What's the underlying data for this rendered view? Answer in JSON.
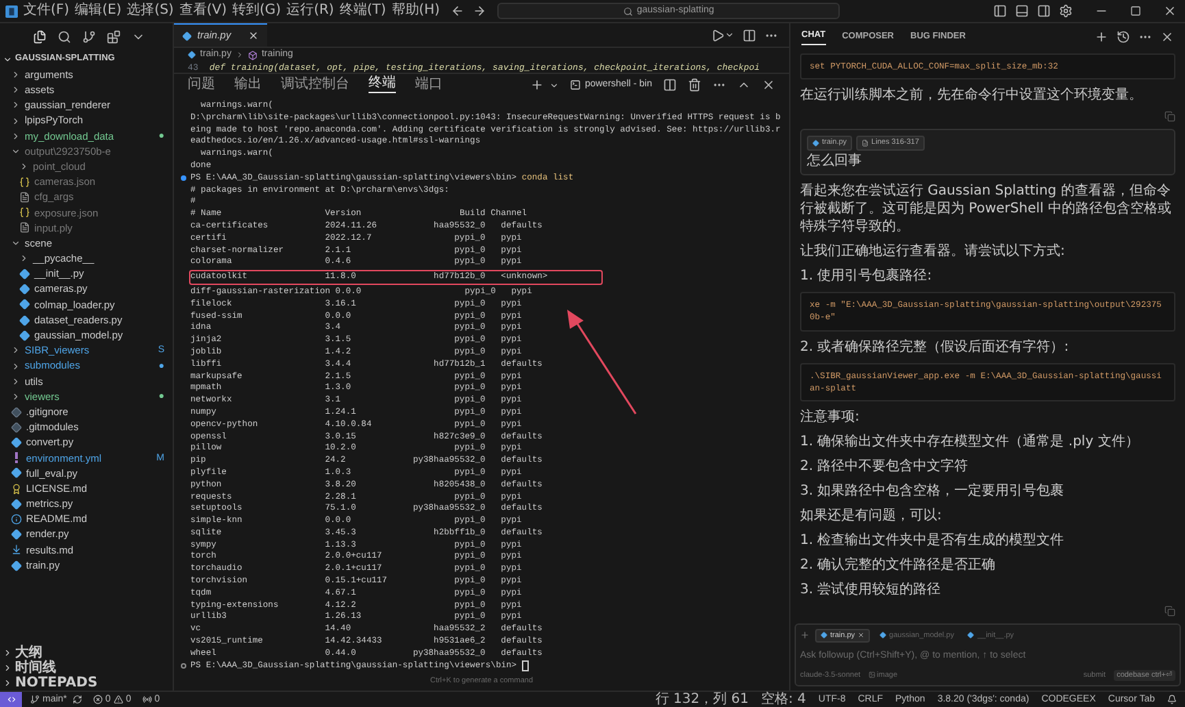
{
  "menu": [
    "文件(F)",
    "编辑(E)",
    "选择(S)",
    "查看(V)",
    "转到(G)",
    "运行(R)",
    "终端(T)",
    "帮助(H)"
  ],
  "search": {
    "value": "gaussian-splatting"
  },
  "explorer": {
    "title": "GAUSSIAN-SPLATTING",
    "items": [
      {
        "name": "arguments",
        "kind": "folder",
        "expanded": false
      },
      {
        "name": "assets",
        "kind": "folder",
        "expanded": false
      },
      {
        "name": "gaussian_renderer",
        "kind": "folder",
        "expanded": false
      },
      {
        "name": "lpipsPyTorch",
        "kind": "folder",
        "expanded": false
      },
      {
        "name": "my_download_data",
        "kind": "folder",
        "expanded": false,
        "color": "#73c991",
        "badge": "●"
      },
      {
        "name": "output\\2923750b-e",
        "kind": "folder",
        "expanded": true,
        "color": "#7a7a7a",
        "children": [
          {
            "name": "point_cloud",
            "kind": "folder",
            "expanded": false,
            "color": "#7a7a7a"
          },
          {
            "name": "cameras.json",
            "kind": "json",
            "color": "#7a7a7a"
          },
          {
            "name": "cfg_args",
            "kind": "text",
            "color": "#7a7a7a"
          },
          {
            "name": "exposure.json",
            "kind": "json",
            "color": "#7a7a7a"
          },
          {
            "name": "input.ply",
            "kind": "text",
            "color": "#7a7a7a"
          }
        ]
      },
      {
        "name": "scene",
        "kind": "folder",
        "expanded": true,
        "children": [
          {
            "name": "__pycache__",
            "kind": "folder",
            "expanded": false
          },
          {
            "name": "__init__.py",
            "kind": "python"
          },
          {
            "name": "cameras.py",
            "kind": "python"
          },
          {
            "name": "colmap_loader.py",
            "kind": "python"
          },
          {
            "name": "dataset_readers.py",
            "kind": "python"
          },
          {
            "name": "gaussian_model.py",
            "kind": "python"
          }
        ]
      },
      {
        "name": "SIBR_viewers",
        "kind": "folder",
        "expanded": false,
        "color": "#4fa5e8",
        "badge": "S"
      },
      {
        "name": "submodules",
        "kind": "folder",
        "expanded": false,
        "color": "#4fa5e8",
        "badge": "●"
      },
      {
        "name": "utils",
        "kind": "folder",
        "expanded": false
      },
      {
        "name": "viewers",
        "kind": "folder",
        "expanded": false,
        "color": "#73c991",
        "badge": "●"
      },
      {
        "name": ".gitignore",
        "kind": "git"
      },
      {
        "name": ".gitmodules",
        "kind": "git"
      },
      {
        "name": "convert.py",
        "kind": "python"
      },
      {
        "name": "environment.yml",
        "kind": "yaml",
        "color": "#4fa5e8",
        "badge": "M"
      },
      {
        "name": "full_eval.py",
        "kind": "python"
      },
      {
        "name": "LICENSE.md",
        "kind": "license"
      },
      {
        "name": "metrics.py",
        "kind": "python"
      },
      {
        "name": "README.md",
        "kind": "info"
      },
      {
        "name": "render.py",
        "kind": "python"
      },
      {
        "name": "results.md",
        "kind": "download"
      },
      {
        "name": "train.py",
        "kind": "python"
      }
    ]
  },
  "sections": [
    "大纲",
    "时间线",
    "NOTEPADS"
  ],
  "editor": {
    "tabs": [
      {
        "label": "train.py",
        "selected": true
      }
    ],
    "breadcrumbs": [
      "train.py",
      "training"
    ],
    "lines": [
      {
        "number": "43",
        "code": "def training(dataset, opt, pipe, testing_iterations, saving_iterations, checkpoint_iterations, checkpoi"
      }
    ]
  },
  "panel": {
    "tabs": [
      {
        "label": "问题",
        "selected": false
      },
      {
        "label": "输出",
        "selected": false
      },
      {
        "label": "调试控制台",
        "selected": false
      },
      {
        "label": "终端",
        "selected": true
      },
      {
        "label": "端口",
        "selected": false
      }
    ],
    "terminal_name": "powershell - bin",
    "before": [
      {
        "kind": "text",
        "text": "  warnings.warn("
      },
      {
        "kind": "text",
        "text": "D:\\prcharm\\lib\\site-packages\\urllib3\\connectionpool.py:1043: InsecureRequestWarning: Unverified HTTPS request is b"
      },
      {
        "kind": "text",
        "text": "eing made to host 'repo.anaconda.com'. Adding certificate verification is strongly advised. See: https://urllib3.r"
      },
      {
        "kind": "text",
        "text": "eadthedocs.io/en/1.26.x/advanced-usage.html#ssl-warnings"
      },
      {
        "kind": "text",
        "text": "  warnings.warn("
      },
      {
        "kind": "text",
        "text": "done"
      },
      {
        "kind": "prompt",
        "path": "PS E:\\AAA_3D_Gaussian-splatting\\gaussian-splatting\\viewers\\bin>",
        "command": "conda list",
        "finished": true
      },
      {
        "kind": "text",
        "text": "# packages in environment at D:\\prcharm\\envs\\3dgs:"
      },
      {
        "kind": "text",
        "text": "#"
      }
    ],
    "columns": [
      "# Name",
      "Version",
      "Build",
      "Channel"
    ],
    "packages": [
      {
        "name": "ca-certificates",
        "version": "2024.11.26",
        "build": "haa95532_0",
        "channel": "defaults",
        "highlighted": false
      },
      {
        "name": "certifi",
        "version": "2022.12.7",
        "build": "pypi_0",
        "channel": "pypi",
        "highlighted": false
      },
      {
        "name": "charset-normalizer",
        "version": "2.1.1",
        "build": "pypi_0",
        "channel": "pypi",
        "highlighted": false
      },
      {
        "name": "colorama",
        "version": "0.4.6",
        "build": "pypi_0",
        "channel": "pypi",
        "highlighted": false
      },
      {
        "name": "cudatoolkit",
        "version": "11.8.0",
        "build": "hd77b12b_0",
        "channel": "<unknown>",
        "highlighted": true
      },
      {
        "name": "diff-gaussian-rasterization",
        "version": "0.0.0",
        "build": "pypi_0",
        "channel": "pypi",
        "highlighted": false
      },
      {
        "name": "filelock",
        "version": "3.16.1",
        "build": "pypi_0",
        "channel": "pypi",
        "highlighted": false
      },
      {
        "name": "fused-ssim",
        "version": "0.0.0",
        "build": "pypi_0",
        "channel": "pypi",
        "highlighted": false
      },
      {
        "name": "idna",
        "version": "3.4",
        "build": "pypi_0",
        "channel": "pypi",
        "highlighted": false
      },
      {
        "name": "jinja2",
        "version": "3.1.5",
        "build": "pypi_0",
        "channel": "pypi",
        "highlighted": false
      },
      {
        "name": "joblib",
        "version": "1.4.2",
        "build": "pypi_0",
        "channel": "pypi",
        "highlighted": false
      },
      {
        "name": "libffi",
        "version": "3.4.4",
        "build": "hd77b12b_1",
        "channel": "defaults",
        "highlighted": false
      },
      {
        "name": "markupsafe",
        "version": "2.1.5",
        "build": "pypi_0",
        "channel": "pypi",
        "highlighted": false
      },
      {
        "name": "mpmath",
        "version": "1.3.0",
        "build": "pypi_0",
        "channel": "pypi",
        "highlighted": false
      },
      {
        "name": "networkx",
        "version": "3.1",
        "build": "pypi_0",
        "channel": "pypi",
        "highlighted": false
      },
      {
        "name": "numpy",
        "version": "1.24.1",
        "build": "pypi_0",
        "channel": "pypi",
        "highlighted": false
      },
      {
        "name": "opencv-python",
        "version": "4.10.0.84",
        "build": "pypi_0",
        "channel": "pypi",
        "highlighted": false
      },
      {
        "name": "openssl",
        "version": "3.0.15",
        "build": "h827c3e9_0",
        "channel": "defaults",
        "highlighted": false
      },
      {
        "name": "pillow",
        "version": "10.2.0",
        "build": "pypi_0",
        "channel": "pypi",
        "highlighted": false
      },
      {
        "name": "pip",
        "version": "24.2",
        "build": "py38haa95532_0",
        "channel": "defaults",
        "highlighted": false
      },
      {
        "name": "plyfile",
        "version": "1.0.3",
        "build": "pypi_0",
        "channel": "pypi",
        "highlighted": false
      },
      {
        "name": "python",
        "version": "3.8.20",
        "build": "h8205438_0",
        "channel": "defaults",
        "highlighted": false
      },
      {
        "name": "requests",
        "version": "2.28.1",
        "build": "pypi_0",
        "channel": "pypi",
        "highlighted": false
      },
      {
        "name": "setuptools",
        "version": "75.1.0",
        "build": "py38haa95532_0",
        "channel": "defaults",
        "highlighted": false
      },
      {
        "name": "simple-knn",
        "version": "0.0.0",
        "build": "pypi_0",
        "channel": "pypi",
        "highlighted": false
      },
      {
        "name": "sqlite",
        "version": "3.45.3",
        "build": "h2bbff1b_0",
        "channel": "defaults",
        "highlighted": false
      },
      {
        "name": "sympy",
        "version": "1.13.3",
        "build": "pypi_0",
        "channel": "pypi",
        "highlighted": false
      },
      {
        "name": "torch",
        "version": "2.0.0+cu117",
        "build": "pypi_0",
        "channel": "pypi",
        "highlighted": false
      },
      {
        "name": "torchaudio",
        "version": "2.0.1+cu117",
        "build": "pypi_0",
        "channel": "pypi",
        "highlighted": false
      },
      {
        "name": "torchvision",
        "version": "0.15.1+cu117",
        "build": "pypi_0",
        "channel": "pypi",
        "highlighted": false
      },
      {
        "name": "tqdm",
        "version": "4.67.1",
        "build": "pypi_0",
        "channel": "pypi",
        "highlighted": false
      },
      {
        "name": "typing-extensions",
        "version": "4.12.2",
        "build": "pypi_0",
        "channel": "pypi",
        "highlighted": false
      },
      {
        "name": "urllib3",
        "version": "1.26.13",
        "build": "pypi_0",
        "channel": "pypi",
        "highlighted": false
      },
      {
        "name": "vc",
        "version": "14.40",
        "build": "haa95532_2",
        "channel": "defaults",
        "highlighted": false
      },
      {
        "name": "vs2015_runtime",
        "version": "14.42.34433",
        "build": "h9531ae6_2",
        "channel": "defaults",
        "highlighted": false
      },
      {
        "name": "wheel",
        "version": "0.44.0",
        "build": "py38haa95532_0",
        "channel": "defaults",
        "highlighted": false
      }
    ],
    "after": [
      {
        "kind": "prompt",
        "path": "PS E:\\AAA_3D_Gaussian-splatting\\gaussian-splatting\\viewers\\bin>",
        "finished": false
      }
    ],
    "hint": "Ctrl+K to generate a command"
  },
  "chat": {
    "tabs": [
      {
        "label": "CHAT",
        "selected": true
      },
      {
        "label": "COMPOSER",
        "selected": false
      },
      {
        "label": "BUG FINDER",
        "selected": false
      }
    ],
    "messages": [
      {
        "kind": "code",
        "text": "set PYTORCH_CUDA_ALLOC_CONF=max_split_size_mb:32"
      },
      {
        "kind": "text",
        "text": "在运行训练脚本之前，先在命令行中设置这个环境变量。"
      },
      {
        "kind": "copy"
      },
      {
        "kind": "user",
        "chips": [
          {
            "label": "train.py",
            "kind": "file"
          },
          {
            "label": "Lines 316-317",
            "kind": "lines"
          }
        ],
        "text": "怎么回事"
      },
      {
        "kind": "text",
        "text": "看起来您在尝试运行 Gaussian Splatting 的查看器，但命令行被截断了。这可能是因为 PowerShell 中的路径包含空格或特殊字符导致的。"
      },
      {
        "kind": "text",
        "text": "让我们正确地运行查看器。请尝试以下方式:"
      },
      {
        "kind": "text",
        "text": "1. 使用引号包裹路径:"
      },
      {
        "kind": "code",
        "text": "xe -m \"E:\\AAA_3D_Gaussian-splatting\\gaussian-splatting\\output\\2923750b-e\""
      },
      {
        "kind": "text",
        "text": "2. 或者确保路径完整（假设后面还有字符）:"
      },
      {
        "kind": "code",
        "text": ".\\SIBR_gaussianViewer_app.exe -m E:\\AAA_3D_Gaussian-splatting\\gaussian-splatt"
      },
      {
        "kind": "text",
        "text": "注意事项:"
      },
      {
        "kind": "text",
        "text": "1. 确保输出文件夹中存在模型文件（通常是 .ply 文件）"
      },
      {
        "kind": "text",
        "text": "2. 路径中不要包含中文字符"
      },
      {
        "kind": "text",
        "text": "3. 如果路径中包含空格，一定要用引号包裹"
      },
      {
        "kind": "text",
        "text": "如果还是有问题，可以:"
      },
      {
        "kind": "text",
        "text": "1. 检查输出文件夹中是否有生成的模型文件"
      },
      {
        "kind": "text",
        "text": "2. 确认完整的文件路径是否正确"
      },
      {
        "kind": "text",
        "text": "3. 尝试使用较短的路径"
      },
      {
        "kind": "copy"
      }
    ],
    "input": {
      "chips": [
        {
          "label": "train.py",
          "selected": true
        },
        {
          "label": "gaussian_model.py",
          "selected": false
        },
        {
          "label": "__init__.py",
          "selected": false
        }
      ],
      "placeholder": "Ask followup (Ctrl+Shift+Y), @ to mention, ↑ to select",
      "model": "claude-3.5-sonnet",
      "image": "image",
      "submit": "submit",
      "codebase": "codebase ctrl+⏎"
    }
  },
  "status_bar": {
    "branch": "main*",
    "errors": "0",
    "warnings": "0",
    "ports": "0",
    "right": [
      "行 132，列 61",
      "空格: 4",
      "UTF-8",
      "CRLF",
      "Python",
      "3.8.20 ('3dgs': conda)",
      "CODEGEEX",
      "Cursor Tab"
    ]
  }
}
